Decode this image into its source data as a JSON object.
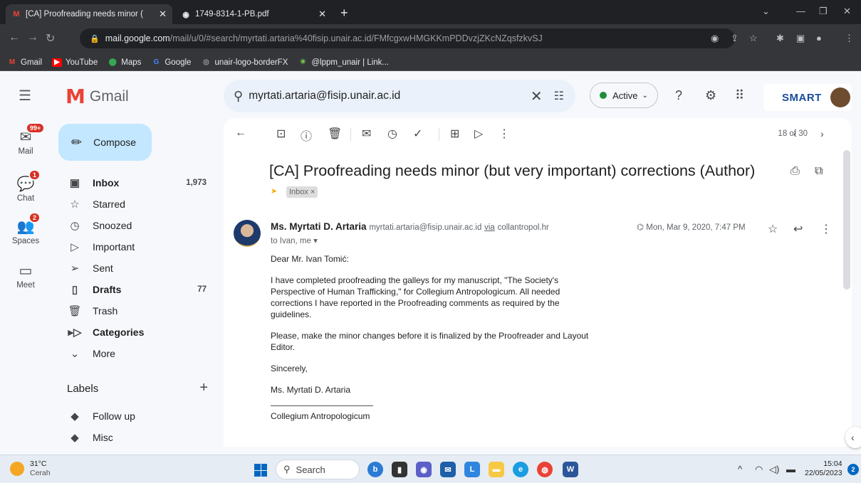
{
  "browser": {
    "tabs": [
      {
        "label": "[CA] Proofreading needs minor (",
        "active": true
      },
      {
        "label": "1749-8314-1-PB.pdf",
        "active": false
      }
    ],
    "url_host": "mail.google.com",
    "url_path": "/mail/u/0/#search/myrtati.artaria%40fisip.unair.ac.id/FMfcgxwHMGKKmPDDvzjZKcNZqsfzkvSJ",
    "bookmarks": [
      "Gmail",
      "YouTube",
      "Maps",
      "Google",
      "unair-logo-borderFX",
      "@lppm_unair | Link..."
    ]
  },
  "header": {
    "app_name": "Gmail",
    "search_value": "myrtati.artaria@fisip.unair.ac.id",
    "status": "Active",
    "brand_badge": "SMART"
  },
  "rail": {
    "mail": {
      "label": "Mail",
      "badge": "99+"
    },
    "chat": {
      "label": "Chat",
      "badge": "1"
    },
    "spaces": {
      "label": "Spaces",
      "badge": "2"
    },
    "meet": {
      "label": "Meet"
    }
  },
  "nav": {
    "compose": "Compose",
    "items": [
      {
        "label": "Inbox",
        "count": "1,973"
      },
      {
        "label": "Starred",
        "count": ""
      },
      {
        "label": "Snoozed",
        "count": ""
      },
      {
        "label": "Important",
        "count": ""
      },
      {
        "label": "Sent",
        "count": ""
      },
      {
        "label": "Drafts",
        "count": "77"
      },
      {
        "label": "Trash",
        "count": ""
      },
      {
        "label": "Categories",
        "count": ""
      },
      {
        "label": "More",
        "count": ""
      }
    ],
    "labels_title": "Labels",
    "labels": [
      "Follow up",
      "Misc"
    ]
  },
  "email": {
    "pager": "18 of 30",
    "subject": "[CA] Proofreading needs minor (but very important) corrections (Author)",
    "label_chip": "Inbox ×",
    "sender_name": "Ms. Myrtati D. Artaria",
    "sender_addr": "myrtati.artaria@fisip.unair.ac.id",
    "via_word": "via",
    "via_domain": "collantropol.hr",
    "to": "to Ivan, me ▾",
    "date": "Mon, Mar 9, 2020, 7:47 PM",
    "body": [
      "Dear Mr. Ivan Tomić:",
      "I have completed proofreading the galleys for my manuscript, \"The Society's Perspective of Human Trafficking,\" for Collegium Antropologicum. All needed corrections I have reported in the Proofreading comments as required by the guidelines.",
      "Please, make the minor changes before it is finalized by the Proofreader and Layout Editor.",
      "Sincerely,",
      "Ms. Myrtati D. Artaria"
    ],
    "signature": "Collegium Antropologicum"
  },
  "taskbar": {
    "temp": "31°C",
    "weather": "Cerah",
    "search": "Search",
    "time": "15:04",
    "date": "22/05/2023",
    "notif_count": "2"
  },
  "colors": {
    "gmail_red": "#ea4335",
    "compose_bg": "#c2e7ff",
    "search_bg": "#eaf1fb",
    "active_green": "#1e8e3e"
  }
}
